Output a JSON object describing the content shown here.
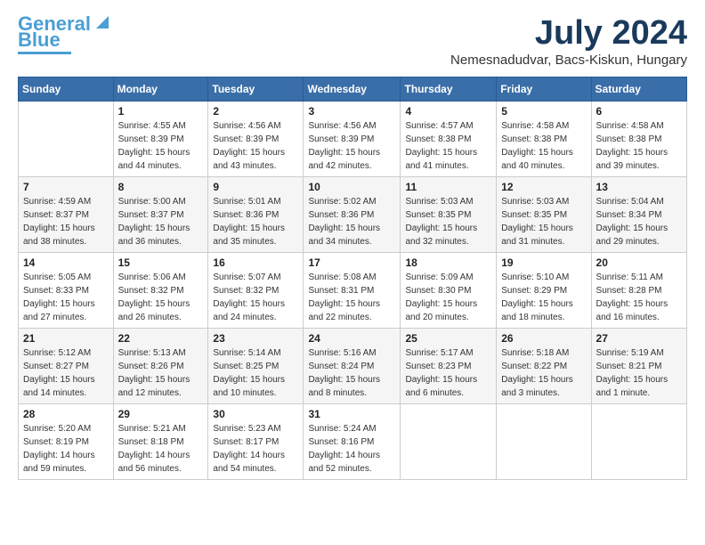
{
  "logo": {
    "line1": "General",
    "line2": "Blue"
  },
  "title": "July 2024",
  "location": "Nemesnadudvar, Bacs-Kiskun, Hungary",
  "weekdays": [
    "Sunday",
    "Monday",
    "Tuesday",
    "Wednesday",
    "Thursday",
    "Friday",
    "Saturday"
  ],
  "weeks": [
    [
      {
        "day": "",
        "sunrise": "",
        "sunset": "",
        "daylight": ""
      },
      {
        "day": "1",
        "sunrise": "Sunrise: 4:55 AM",
        "sunset": "Sunset: 8:39 PM",
        "daylight": "Daylight: 15 hours and 44 minutes."
      },
      {
        "day": "2",
        "sunrise": "Sunrise: 4:56 AM",
        "sunset": "Sunset: 8:39 PM",
        "daylight": "Daylight: 15 hours and 43 minutes."
      },
      {
        "day": "3",
        "sunrise": "Sunrise: 4:56 AM",
        "sunset": "Sunset: 8:39 PM",
        "daylight": "Daylight: 15 hours and 42 minutes."
      },
      {
        "day": "4",
        "sunrise": "Sunrise: 4:57 AM",
        "sunset": "Sunset: 8:38 PM",
        "daylight": "Daylight: 15 hours and 41 minutes."
      },
      {
        "day": "5",
        "sunrise": "Sunrise: 4:58 AM",
        "sunset": "Sunset: 8:38 PM",
        "daylight": "Daylight: 15 hours and 40 minutes."
      },
      {
        "day": "6",
        "sunrise": "Sunrise: 4:58 AM",
        "sunset": "Sunset: 8:38 PM",
        "daylight": "Daylight: 15 hours and 39 minutes."
      }
    ],
    [
      {
        "day": "7",
        "sunrise": "Sunrise: 4:59 AM",
        "sunset": "Sunset: 8:37 PM",
        "daylight": "Daylight: 15 hours and 38 minutes."
      },
      {
        "day": "8",
        "sunrise": "Sunrise: 5:00 AM",
        "sunset": "Sunset: 8:37 PM",
        "daylight": "Daylight: 15 hours and 36 minutes."
      },
      {
        "day": "9",
        "sunrise": "Sunrise: 5:01 AM",
        "sunset": "Sunset: 8:36 PM",
        "daylight": "Daylight: 15 hours and 35 minutes."
      },
      {
        "day": "10",
        "sunrise": "Sunrise: 5:02 AM",
        "sunset": "Sunset: 8:36 PM",
        "daylight": "Daylight: 15 hours and 34 minutes."
      },
      {
        "day": "11",
        "sunrise": "Sunrise: 5:03 AM",
        "sunset": "Sunset: 8:35 PM",
        "daylight": "Daylight: 15 hours and 32 minutes."
      },
      {
        "day": "12",
        "sunrise": "Sunrise: 5:03 AM",
        "sunset": "Sunset: 8:35 PM",
        "daylight": "Daylight: 15 hours and 31 minutes."
      },
      {
        "day": "13",
        "sunrise": "Sunrise: 5:04 AM",
        "sunset": "Sunset: 8:34 PM",
        "daylight": "Daylight: 15 hours and 29 minutes."
      }
    ],
    [
      {
        "day": "14",
        "sunrise": "Sunrise: 5:05 AM",
        "sunset": "Sunset: 8:33 PM",
        "daylight": "Daylight: 15 hours and 27 minutes."
      },
      {
        "day": "15",
        "sunrise": "Sunrise: 5:06 AM",
        "sunset": "Sunset: 8:32 PM",
        "daylight": "Daylight: 15 hours and 26 minutes."
      },
      {
        "day": "16",
        "sunrise": "Sunrise: 5:07 AM",
        "sunset": "Sunset: 8:32 PM",
        "daylight": "Daylight: 15 hours and 24 minutes."
      },
      {
        "day": "17",
        "sunrise": "Sunrise: 5:08 AM",
        "sunset": "Sunset: 8:31 PM",
        "daylight": "Daylight: 15 hours and 22 minutes."
      },
      {
        "day": "18",
        "sunrise": "Sunrise: 5:09 AM",
        "sunset": "Sunset: 8:30 PM",
        "daylight": "Daylight: 15 hours and 20 minutes."
      },
      {
        "day": "19",
        "sunrise": "Sunrise: 5:10 AM",
        "sunset": "Sunset: 8:29 PM",
        "daylight": "Daylight: 15 hours and 18 minutes."
      },
      {
        "day": "20",
        "sunrise": "Sunrise: 5:11 AM",
        "sunset": "Sunset: 8:28 PM",
        "daylight": "Daylight: 15 hours and 16 minutes."
      }
    ],
    [
      {
        "day": "21",
        "sunrise": "Sunrise: 5:12 AM",
        "sunset": "Sunset: 8:27 PM",
        "daylight": "Daylight: 15 hours and 14 minutes."
      },
      {
        "day": "22",
        "sunrise": "Sunrise: 5:13 AM",
        "sunset": "Sunset: 8:26 PM",
        "daylight": "Daylight: 15 hours and 12 minutes."
      },
      {
        "day": "23",
        "sunrise": "Sunrise: 5:14 AM",
        "sunset": "Sunset: 8:25 PM",
        "daylight": "Daylight: 15 hours and 10 minutes."
      },
      {
        "day": "24",
        "sunrise": "Sunrise: 5:16 AM",
        "sunset": "Sunset: 8:24 PM",
        "daylight": "Daylight: 15 hours and 8 minutes."
      },
      {
        "day": "25",
        "sunrise": "Sunrise: 5:17 AM",
        "sunset": "Sunset: 8:23 PM",
        "daylight": "Daylight: 15 hours and 6 minutes."
      },
      {
        "day": "26",
        "sunrise": "Sunrise: 5:18 AM",
        "sunset": "Sunset: 8:22 PM",
        "daylight": "Daylight: 15 hours and 3 minutes."
      },
      {
        "day": "27",
        "sunrise": "Sunrise: 5:19 AM",
        "sunset": "Sunset: 8:21 PM",
        "daylight": "Daylight: 15 hours and 1 minute."
      }
    ],
    [
      {
        "day": "28",
        "sunrise": "Sunrise: 5:20 AM",
        "sunset": "Sunset: 8:19 PM",
        "daylight": "Daylight: 14 hours and 59 minutes."
      },
      {
        "day": "29",
        "sunrise": "Sunrise: 5:21 AM",
        "sunset": "Sunset: 8:18 PM",
        "daylight": "Daylight: 14 hours and 56 minutes."
      },
      {
        "day": "30",
        "sunrise": "Sunrise: 5:23 AM",
        "sunset": "Sunset: 8:17 PM",
        "daylight": "Daylight: 14 hours and 54 minutes."
      },
      {
        "day": "31",
        "sunrise": "Sunrise: 5:24 AM",
        "sunset": "Sunset: 8:16 PM",
        "daylight": "Daylight: 14 hours and 52 minutes."
      },
      {
        "day": "",
        "sunrise": "",
        "sunset": "",
        "daylight": ""
      },
      {
        "day": "",
        "sunrise": "",
        "sunset": "",
        "daylight": ""
      },
      {
        "day": "",
        "sunrise": "",
        "sunset": "",
        "daylight": ""
      }
    ]
  ]
}
